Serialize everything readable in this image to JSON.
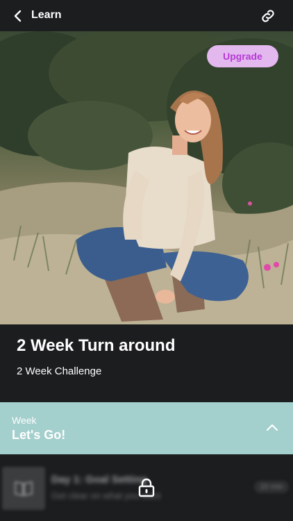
{
  "header": {
    "title": "Learn",
    "back_icon": "chevron-left-icon",
    "link_icon": "link-icon"
  },
  "hero": {
    "upgrade_label": "Upgrade",
    "accent_bg": "#e3b8ee",
    "accent_text": "#b53ad6"
  },
  "program": {
    "title": "2 Week Turn around",
    "subtitle": "2 Week Challenge"
  },
  "week": {
    "label": "Week",
    "name": "Let's Go!",
    "color": "#a3cfcc",
    "expand_icon": "chevron-up-icon"
  },
  "lessons": [
    {
      "title": "Day 1: Goal Setting",
      "description": "Get clear on what you want",
      "duration": "20 min",
      "locked": true,
      "lock_icon": "lock-icon"
    }
  ]
}
